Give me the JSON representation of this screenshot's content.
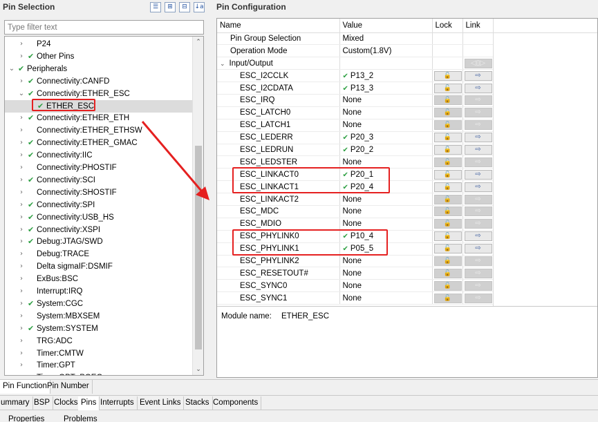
{
  "pin_selection": {
    "title": "Pin Selection",
    "filter_placeholder": "Type filter text",
    "tools": [
      "list-icon",
      "expand-all-icon",
      "collapse-all-icon",
      "sort-az-icon"
    ],
    "tree": [
      {
        "label": "P24",
        "level": 2,
        "twisty": "collapsed",
        "check": false
      },
      {
        "label": "Other Pins",
        "level": 2,
        "twisty": "collapsed",
        "check": true
      },
      {
        "label": "Peripherals",
        "level": 1,
        "twisty": "expanded",
        "check": true
      },
      {
        "label": "Connectivity:CANFD",
        "level": 2,
        "twisty": "collapsed",
        "check": true
      },
      {
        "label": "Connectivity:ETHER_ESC",
        "level": 2,
        "twisty": "expanded",
        "check": true
      },
      {
        "label": "ETHER_ESC",
        "level": 3,
        "twisty": "none",
        "check": true,
        "selected": true
      },
      {
        "label": "Connectivity:ETHER_ETH",
        "level": 2,
        "twisty": "collapsed",
        "check": true
      },
      {
        "label": "Connectivity:ETHER_ETHSW",
        "level": 2,
        "twisty": "collapsed",
        "check": false
      },
      {
        "label": "Connectivity:ETHER_GMAC",
        "level": 2,
        "twisty": "collapsed",
        "check": true
      },
      {
        "label": "Connectivity:IIC",
        "level": 2,
        "twisty": "collapsed",
        "check": true
      },
      {
        "label": "Connectivity:PHOSTIF",
        "level": 2,
        "twisty": "collapsed",
        "check": false
      },
      {
        "label": "Connectivity:SCI",
        "level": 2,
        "twisty": "collapsed",
        "check": true
      },
      {
        "label": "Connectivity:SHOSTIF",
        "level": 2,
        "twisty": "collapsed",
        "check": false
      },
      {
        "label": "Connectivity:SPI",
        "level": 2,
        "twisty": "collapsed",
        "check": true
      },
      {
        "label": "Connectivity:USB_HS",
        "level": 2,
        "twisty": "collapsed",
        "check": true
      },
      {
        "label": "Connectivity:XSPI",
        "level": 2,
        "twisty": "collapsed",
        "check": true
      },
      {
        "label": "Debug:JTAG/SWD",
        "level": 2,
        "twisty": "collapsed",
        "check": true
      },
      {
        "label": "Debug:TRACE",
        "level": 2,
        "twisty": "collapsed",
        "check": false
      },
      {
        "label": "Delta sigmaIF:DSMIF",
        "level": 2,
        "twisty": "collapsed",
        "check": false
      },
      {
        "label": "ExBus:BSC",
        "level": 2,
        "twisty": "collapsed",
        "check": false
      },
      {
        "label": "Interrupt:IRQ",
        "level": 2,
        "twisty": "collapsed",
        "check": false
      },
      {
        "label": "System:CGC",
        "level": 2,
        "twisty": "collapsed",
        "check": true
      },
      {
        "label": "System:MBXSEM",
        "level": 2,
        "twisty": "collapsed",
        "check": false
      },
      {
        "label": "System:SYSTEM",
        "level": 2,
        "twisty": "collapsed",
        "check": true
      },
      {
        "label": "TRG:ADC",
        "level": 2,
        "twisty": "collapsed",
        "check": false
      },
      {
        "label": "Timer:CMTW",
        "level": 2,
        "twisty": "collapsed",
        "check": false
      },
      {
        "label": "Timer:GPT",
        "level": 2,
        "twisty": "collapsed",
        "check": false
      },
      {
        "label": "Timer:GPT_POEG",
        "level": 2,
        "twisty": "collapsed",
        "check": false
      }
    ]
  },
  "pin_config": {
    "title": "Pin Configuration",
    "headers": {
      "name": "Name",
      "value": "Value",
      "lock": "Lock",
      "link": "Link"
    },
    "top_rows": [
      {
        "name": "Pin Group Selection",
        "value": "Mixed"
      },
      {
        "name": "Operation Mode",
        "value": "Custom(1.8V)"
      }
    ],
    "group_label": "Input/Output",
    "pins": [
      {
        "name": "ESC_I2CCLK",
        "value": "P13_2",
        "check": true
      },
      {
        "name": "ESC_I2CDATA",
        "value": "P13_3",
        "check": true
      },
      {
        "name": "ESC_IRQ",
        "value": "None",
        "check": false
      },
      {
        "name": "ESC_LATCH0",
        "value": "None",
        "check": false
      },
      {
        "name": "ESC_LATCH1",
        "value": "None",
        "check": false
      },
      {
        "name": "ESC_LEDERR",
        "value": "P20_3",
        "check": true
      },
      {
        "name": "ESC_LEDRUN",
        "value": "P20_2",
        "check": true
      },
      {
        "name": "ESC_LEDSTER",
        "value": "None",
        "check": false
      },
      {
        "name": "ESC_LINKACT0",
        "value": "P20_1",
        "check": true
      },
      {
        "name": "ESC_LINKACT1",
        "value": "P20_4",
        "check": true
      },
      {
        "name": "ESC_LINKACT2",
        "value": "None",
        "check": false
      },
      {
        "name": "ESC_MDC",
        "value": "None",
        "check": false
      },
      {
        "name": "ESC_MDIO",
        "value": "None",
        "check": false
      },
      {
        "name": "ESC_PHYLINK0",
        "value": "P10_4",
        "check": true
      },
      {
        "name": "ESC_PHYLINK1",
        "value": "P05_5",
        "check": true
      },
      {
        "name": "ESC_PHYLINK2",
        "value": "None",
        "check": false
      },
      {
        "name": "ESC_RESETOUT#",
        "value": "None",
        "check": false
      },
      {
        "name": "ESC_SYNC0",
        "value": "None",
        "check": false
      },
      {
        "name": "ESC_SYNC1",
        "value": "None",
        "check": false
      }
    ],
    "module_label": "Module name:",
    "module_value": "ETHER_ESC"
  },
  "bottom_tabs_1": [
    "Pin Function",
    "Pin Number"
  ],
  "bottom_tabs_2": [
    "ummary",
    "BSP",
    "Clocks",
    "Pins",
    "Interrupts",
    "Event Links",
    "Stacks",
    "Components"
  ],
  "bottom_tabs_3": [
    "Properties",
    "Problems"
  ],
  "colors": {
    "annotation": "#e52020",
    "check": "#2ea043"
  }
}
